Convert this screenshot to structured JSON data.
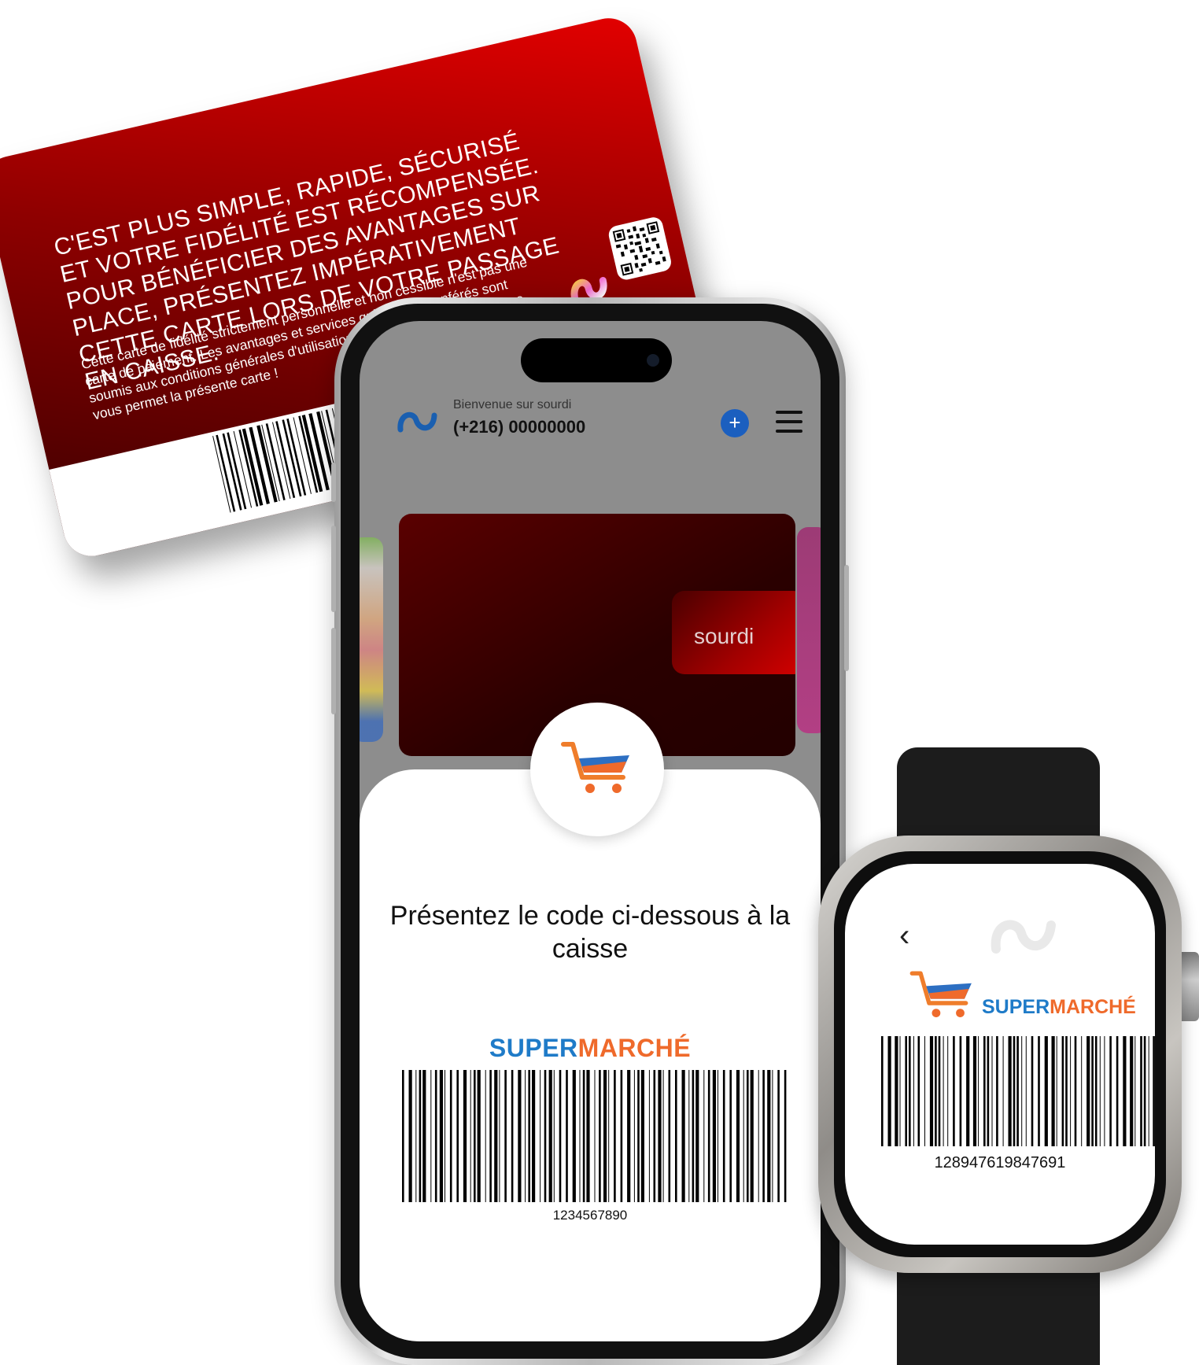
{
  "card": {
    "headline": "C'est plus simple, rapide, sécurisé et votre fidélité est récompensée. Pour bénéficier des avantages sur place, présentez impérativement cette carte lors de votre passage en caisse.",
    "body": "Cette carte de fidélité strictement personnelle et non cessible n'est pas une carte de paiement. Les avantages et services qui lui sont conférés sont soumis aux conditions générales d'utilisation. Profitez des avantages que vous permet la présente carte !"
  },
  "phone": {
    "header": {
      "welcome": "Bienvenue sur sourdi",
      "phone_number": "(+216) 00000000",
      "add_symbol": "+"
    },
    "card_label": "sourdi",
    "instruction": "Présentez le code ci-dessous à la caisse",
    "brand_super": "SUPER",
    "brand_marche": "MARCHÉ",
    "code": "1234567890"
  },
  "watch": {
    "back_symbol": "‹",
    "brand_super": "SUPER",
    "brand_marche": "MARCHÉ",
    "code": "128947619847691"
  },
  "colors": {
    "card_red": "#e30000",
    "card_dark": "#3a0000",
    "brand_blue": "#1f7bc8",
    "brand_orange": "#ef6a2b",
    "add_button": "#1b5fbf"
  },
  "icons": [
    "sourdi-logo-icon",
    "qr-code-icon",
    "shopping-cart-icon",
    "plus-icon",
    "menu-icon",
    "chevron-left-icon"
  ]
}
